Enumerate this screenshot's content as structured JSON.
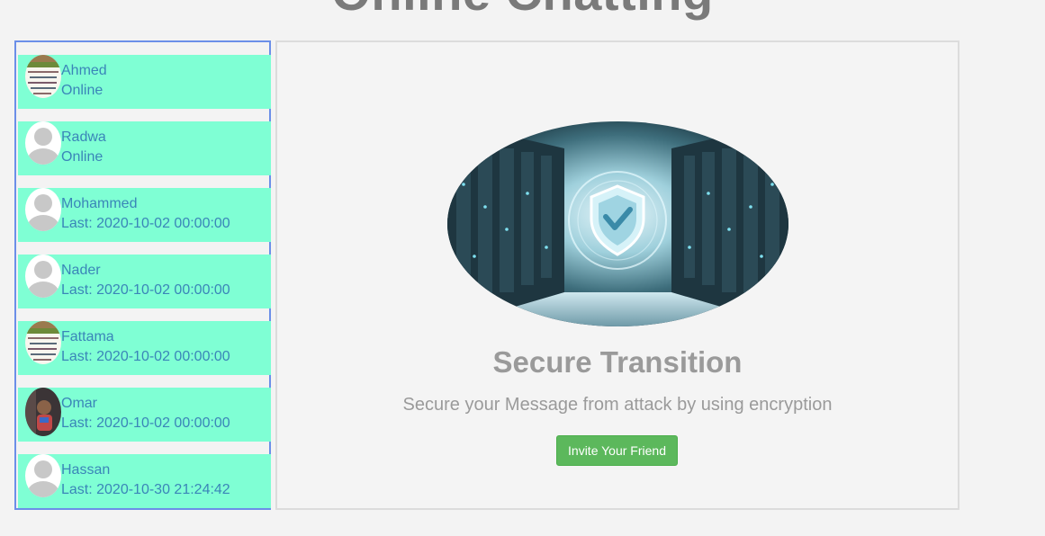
{
  "page": {
    "title": "Online Chatting"
  },
  "users": [
    {
      "name": "Ahmed",
      "status": "Online",
      "avatar": "photo-avatar-icon"
    },
    {
      "name": "Radwa",
      "status": "Online",
      "avatar": "default-avatar-icon"
    },
    {
      "name": "Mohammed",
      "status": "Last: 2020-10-02 00:00:00",
      "avatar": "default-avatar-icon"
    },
    {
      "name": "Nader",
      "status": "Last: 2020-10-02 00:00:00",
      "avatar": "default-avatar-icon"
    },
    {
      "name": "Fattama",
      "status": "Last: 2020-10-02 00:00:00",
      "avatar": "photo-avatar-icon"
    },
    {
      "name": "Omar",
      "status": "Last: 2020-10-02 00:00:00",
      "avatar": "photo-avatar-icon"
    },
    {
      "name": "Hassan",
      "status": "Last: 2020-10-30 21:24:42",
      "avatar": "default-avatar-icon"
    }
  ],
  "main": {
    "image": "server-room-shield-image",
    "title": "Secure Transition",
    "subtitle": "Secure your Message from attack by using encryption",
    "invite_label": "Invite Your Friend"
  },
  "colors": {
    "list_item_bg": "#7fffd4",
    "list_border": "#6b8fe8",
    "text_link": "#3a85b8",
    "button": "#5cb85c",
    "muted_text": "#9a9a9a"
  }
}
